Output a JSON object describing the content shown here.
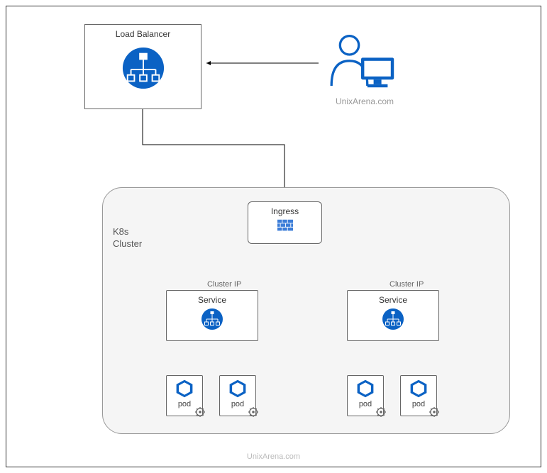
{
  "loadBalancer": {
    "title": "Load Balancer"
  },
  "user": {
    "label": "UnixArena.com"
  },
  "cluster": {
    "label": "K8s\nCluster"
  },
  "ingress": {
    "title": "Ingress"
  },
  "services": {
    "clusterIpLabel": "Cluster IP",
    "service1": {
      "title": "Service"
    },
    "service2": {
      "title": "Service"
    }
  },
  "pods": {
    "pod1": {
      "label": "pod"
    },
    "pod2": {
      "label": "pod"
    },
    "pod3": {
      "label": "pod"
    },
    "pod4": {
      "label": "pod"
    }
  },
  "watermark": "UnixArena.com"
}
